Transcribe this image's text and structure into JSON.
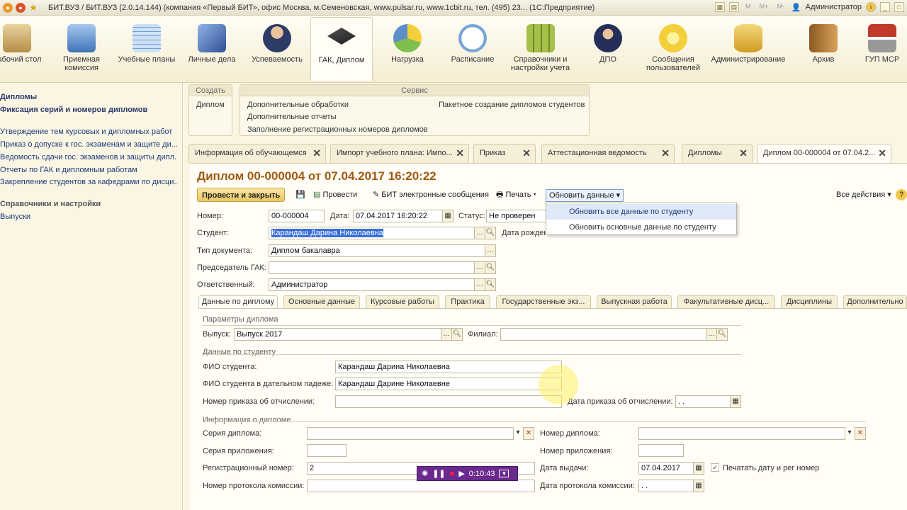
{
  "window": {
    "title": "БИТ.ВУЗ / БИТ.ВУЗ (2.0.14.144) (компания «Первый БИТ», офис Москва, м.Семеновская, www.pulsar.ru, www.1cbit.ru, тел. (495) 23... (1С:Предприятие)",
    "user": "Администратор",
    "mini_buttons": [
      "M",
      "M+",
      "M-"
    ]
  },
  "sections": [
    {
      "label": "Рабочий стол",
      "icon": "desk-lamp-icon",
      "color": "#c9a45a"
    },
    {
      "label": "Приемная комиссия",
      "icon": "building-icon",
      "color": "#5c8fc9"
    },
    {
      "label": "Учебные планы",
      "icon": "table-icon",
      "color": "#6fa0d8"
    },
    {
      "label": "Личные дела",
      "icon": "folder-icon",
      "color": "#4a6fb3"
    },
    {
      "label": "Успеваемость",
      "icon": "student-icon",
      "color": "#2d3b66"
    },
    {
      "label": "ГАК, Диплом",
      "icon": "graduation-cap-icon",
      "color": "#2b2b2b"
    },
    {
      "label": "Нагрузка",
      "icon": "pie-chart-icon",
      "color": "#7fbf4f"
    },
    {
      "label": "Расписание",
      "icon": "clock-icon",
      "color": "#7aa6d6"
    },
    {
      "label": "Справочники и настройки учета",
      "icon": "binders-icon",
      "color": "#8faa3a"
    },
    {
      "label": "ДПО",
      "icon": "graduate-icon",
      "color": "#24305a"
    },
    {
      "label": "Сообщения пользователей",
      "icon": "message-icon",
      "color": "#f2cf3b"
    },
    {
      "label": "Администрирование",
      "icon": "database-icon",
      "color": "#e0b744"
    },
    {
      "label": "Архив",
      "icon": "archive-book-icon",
      "color": "#c48a3a"
    },
    {
      "label": "ГУП МСР",
      "icon": "msr-logo-icon",
      "color": "#c0392b"
    }
  ],
  "leftnav": {
    "items": [
      {
        "label": "Дипломы",
        "bold": true
      },
      {
        "label": "Фиксация серий и номеров дипломов",
        "bold": true
      },
      {
        "label": "Утверждение тем курсовых и дипломных работ",
        "bold": false
      },
      {
        "label": "Приказ о допуске к гос. экзаменам и защите ди...",
        "bold": false
      },
      {
        "label": "Ведомость сдачи гос. экзаменов и защиты дипл...",
        "bold": false
      },
      {
        "label": "Отчеты по ГАК и дипломным работам",
        "bold": false
      },
      {
        "label": "Закрепление студентов за кафедрами по дисци...",
        "bold": false
      },
      {
        "label": "Справочники и настройки",
        "bold": true
      },
      {
        "label": "Выпуски",
        "bold": false
      }
    ]
  },
  "create_box": {
    "header": "Создать",
    "items": [
      "Диплом"
    ]
  },
  "service_box": {
    "header": "Сервис",
    "left": [
      "Дополнительные обработки",
      "Дополнительные отчеты",
      "Заполнение регистрационных номеров дипломов"
    ],
    "right": [
      "Пакетное создание дипломов студентов"
    ]
  },
  "open_tabs": [
    "Информация об обучающемся",
    "Импорт учебного плана: Импо...",
    "Приказ",
    "Аттестационная ведомость",
    "Дипломы",
    "Диплом 00-000004 от 07.04.2..."
  ],
  "form": {
    "title": "Диплом 00-000004 от 07.04.2017 16:20:22",
    "toolbar": {
      "post_close": "Провести и закрыть",
      "post": "Провести",
      "bit_messages": "БИТ электронные сообщения",
      "print": "Печать",
      "update": "Обновить данные",
      "all_actions": "Все действия"
    },
    "update_menu": [
      "Обновить все данные по студенту",
      "Обновить основные данные по студенту"
    ],
    "number_label": "Номер:",
    "number": "00-000004",
    "date_label": "Дата:",
    "date": "07.04.2017 16:20:22",
    "status_label": "Статус:",
    "status": "Не проверен",
    "student_label": "Студент:",
    "student": "Карандаш Дарина Николаевна",
    "birth_label": "Дата рожден",
    "doctype_label": "Тип документа:",
    "doctype": "Диплом бакалавра",
    "chairman_label": "Председатель ГАК:",
    "chairman": "",
    "responsible_label": "Ответственный:",
    "responsible": "Администратор",
    "inner_tabs": [
      "Данные по диплому",
      "Основные данные",
      "Курсовые работы",
      "Практика",
      "Государственные экз...",
      "Выпускная работа",
      "Факультативные дисц...",
      "Дисциплины",
      "Дополнительно"
    ],
    "groups": {
      "params": "Параметры диплома",
      "student": "Данные по студенту",
      "diploma": "Информация о дипломе"
    },
    "release_label": "Выпуск:",
    "release": "Выпуск 2017",
    "branch_label": "Филиал:",
    "branch": "",
    "fio_label": "ФИО студента:",
    "fio": "Карандаш Дарина Николаевна",
    "fio_dat_label": "ФИО студента в дательном падеже:",
    "fio_dat": "Карандаш Дарине Николаевне",
    "expel_order_label": "Номер приказа об отчислении:",
    "expel_order": "",
    "expel_date_label": "Дата приказа об отчислении:",
    "expel_date": " .  .",
    "series_label": "Серия диплома:",
    "series": "",
    "dip_number_label": "Номер диплома:",
    "dip_number": "",
    "app_series_label": "Серия приложения:",
    "app_series": "",
    "app_number_label": "Номер приложения:",
    "app_number": "",
    "reg_label": "Регистрационный номер:",
    "reg": "2",
    "issue_label": "Дата выдачи:",
    "issue": "07.04.2017",
    "print_check_label": "Печатать дату и рег номер",
    "protocol_label": "Номер протокола комиссии:",
    "protocol": "",
    "protocol_date_label": "Дата протокола комиссии:",
    "protocol_date": " .  ."
  },
  "recorder": {
    "time": "0:10:43"
  }
}
